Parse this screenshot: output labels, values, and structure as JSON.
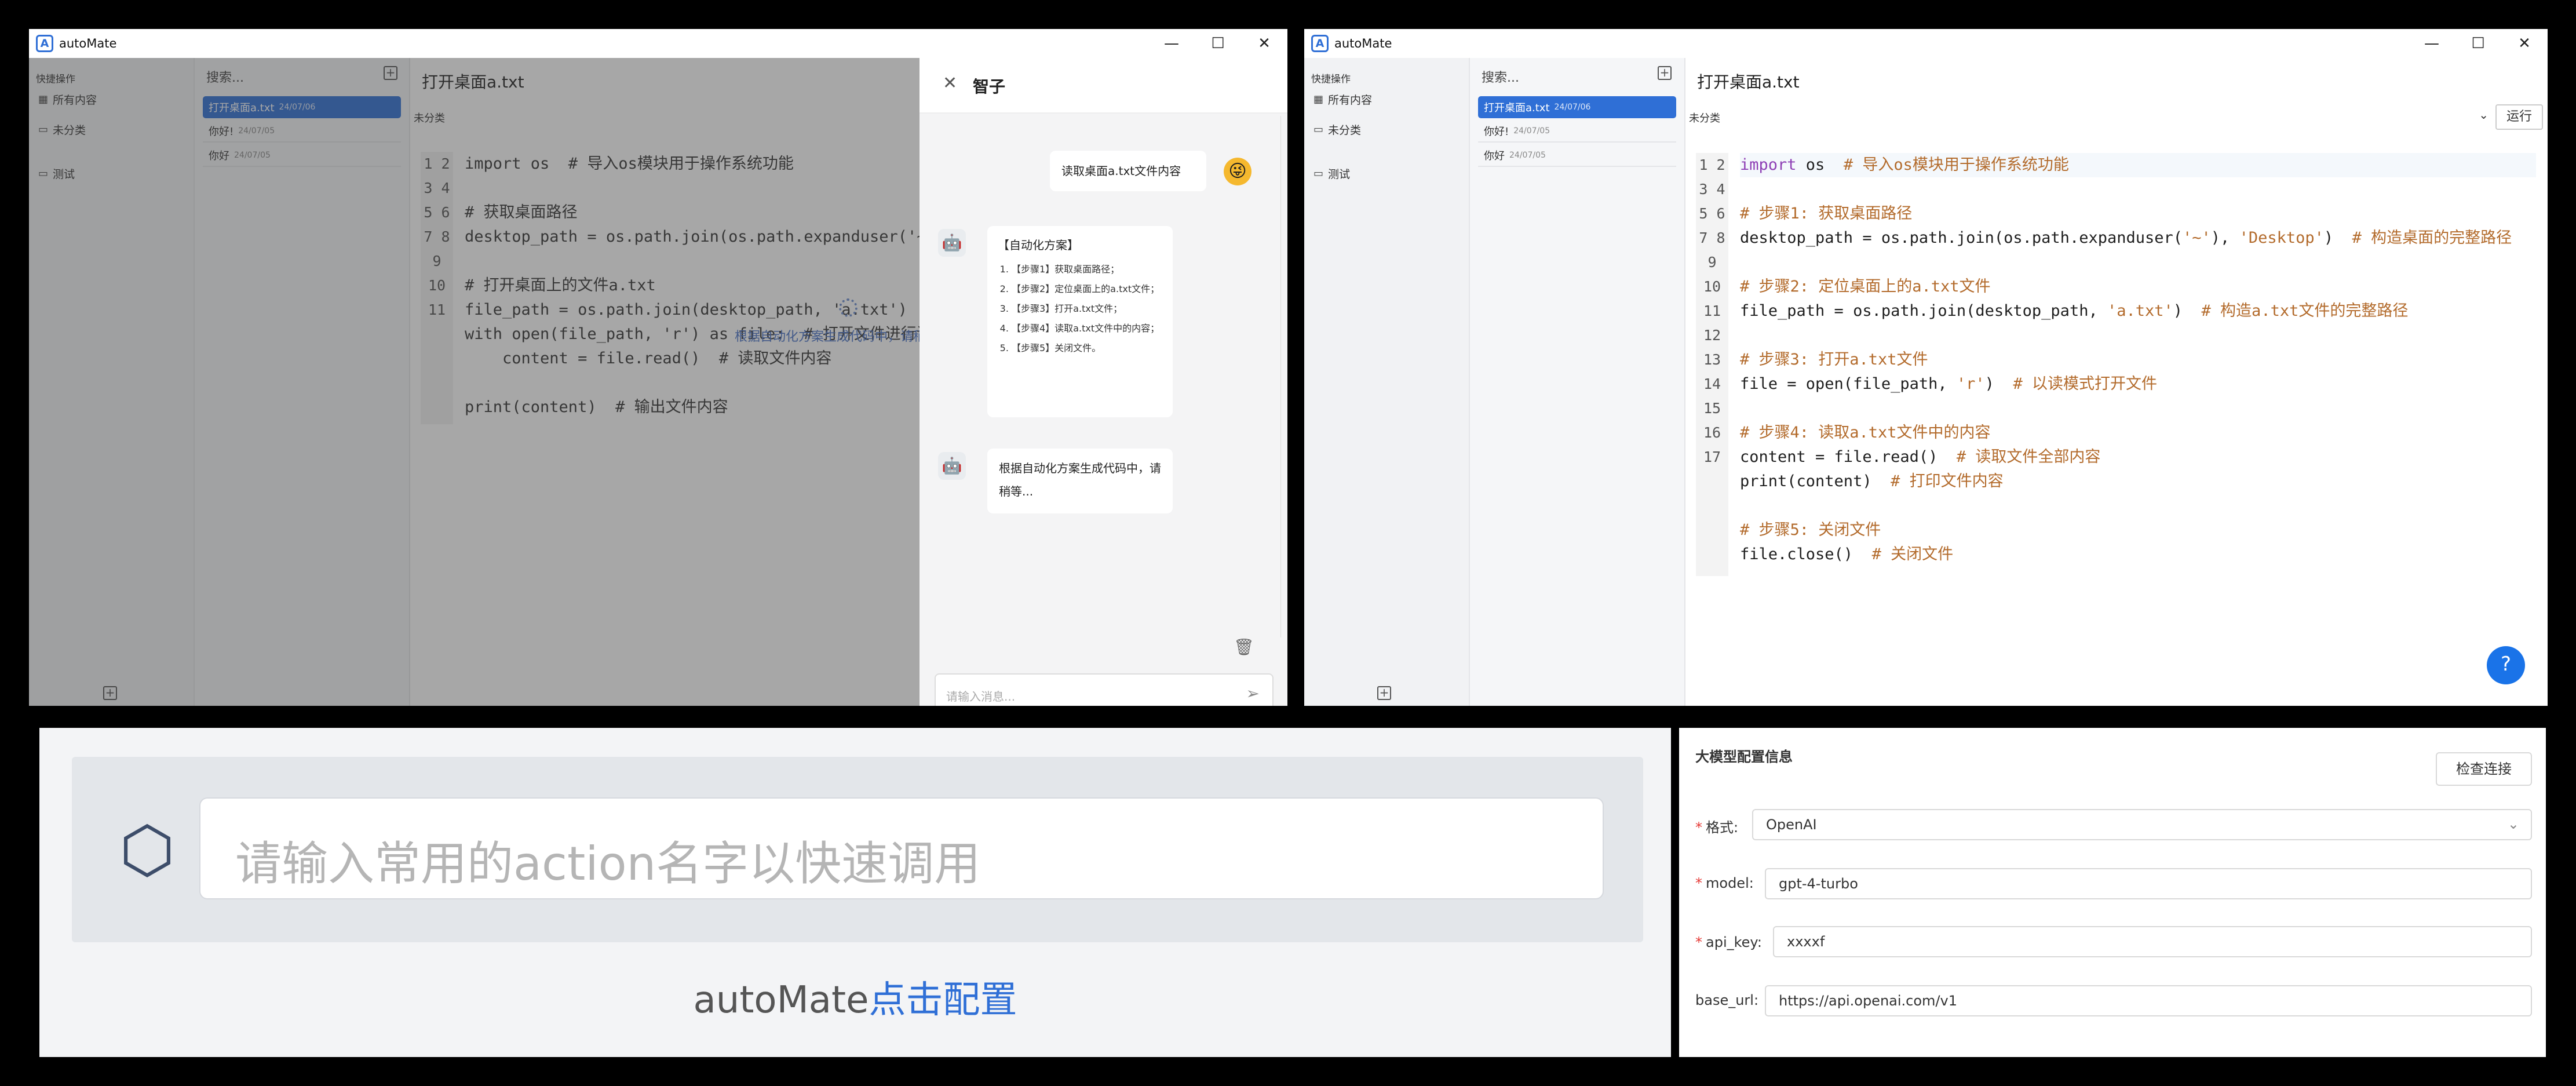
{
  "app": {
    "title": "autoMate"
  },
  "left_window": {
    "sidebar": {
      "header": "快捷操作",
      "items": [
        {
          "icon": "grid-icon",
          "label": "所有内容"
        },
        {
          "icon": "folder-icon",
          "label": "未分类"
        },
        {
          "icon": "folder-icon",
          "label": "测试"
        }
      ]
    },
    "notes": {
      "search_placeholder": "搜索...",
      "items": [
        {
          "title": "打开桌面a.txt",
          "date": "24/07/06",
          "selected": true
        },
        {
          "title": "你好!",
          "date": "24/07/05"
        },
        {
          "title": "你好",
          "date": "24/07/05"
        }
      ]
    },
    "editor": {
      "title": "打开桌面a.txt",
      "category": "未分类",
      "loading_text": "根据自动化方案生成代码中，请稍等...",
      "lines": [
        "import os  # 导入os模块用于操作系统功能",
        "",
        "# 获取桌面路径",
        "desktop_path = os.path.join(os.path.expanduser('~'), ",
        "",
        "# 打开桌面上的文件a.txt",
        "file_path = os.path.join(desktop_path, 'a.txt')  # ",
        "with open(file_path, 'r') as file:  # 打开文件进行读",
        "    content = file.read()  # 读取文件内容",
        "",
        "print(content)  # 输出文件内容"
      ]
    },
    "chat": {
      "title": "智子",
      "user_message": "读取桌面a.txt文件内容",
      "plan_title": "【自动化方案】",
      "plan_steps": [
        "【步骤1】获取桌面路径；",
        "【步骤2】定位桌面上的a.txt文件；",
        "【步骤3】打开a.txt文件；",
        "【步骤4】读取a.txt文件中的内容；",
        "【步骤5】关闭文件。"
      ],
      "status_message": "根据自动化方案生成代码中，请稍等...",
      "input_placeholder": "请输入消息..."
    }
  },
  "right_window": {
    "sidebar": {
      "header": "快捷操作",
      "items": [
        {
          "icon": "grid-icon",
          "label": "所有内容"
        },
        {
          "icon": "folder-icon",
          "label": "未分类"
        },
        {
          "icon": "folder-icon",
          "label": "测试"
        }
      ]
    },
    "notes": {
      "search_placeholder": "搜索...",
      "items": [
        {
          "title": "打开桌面a.txt",
          "date": "24/07/06",
          "selected": true
        },
        {
          "title": "你好!",
          "date": "24/07/05"
        },
        {
          "title": "你好",
          "date": "24/07/05"
        }
      ]
    },
    "editor": {
      "title": "打开桌面a.txt",
      "category": "未分类",
      "run_label": "运行"
    }
  },
  "quick_bar": {
    "placeholder": "请输入常用的action名字以快速调用",
    "footer_prefix": "autoMate",
    "footer_link": "点击配置"
  },
  "llm_config": {
    "title": "大模型配置信息",
    "check_button": "检查连接",
    "fields": [
      {
        "label": "格式:",
        "value": "OpenAI",
        "required": true
      },
      {
        "label": "model:",
        "value": "gpt-4-turbo",
        "required": true
      },
      {
        "label": "api_key:",
        "value": "xxxxf",
        "required": true
      },
      {
        "label": "base_url:",
        "value": "https://api.openai.com/v1",
        "required": false
      }
    ]
  }
}
